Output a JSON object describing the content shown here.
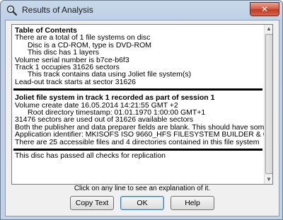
{
  "window": {
    "title": "Results of Analysis",
    "close_glyph": "✕"
  },
  "report": {
    "toc": {
      "heading": "Table of Contents",
      "lines": [
        {
          "text": "There are a total of 1 file systems on disc",
          "indent": false
        },
        {
          "text": "Disc is a CD-ROM, type is DVD-ROM",
          "indent": true
        },
        {
          "text": "This disc has 1 layers",
          "indent": true
        },
        {
          "text": "Volume serial number is b7ce-b6f3",
          "indent": false
        },
        {
          "text": "Track 1 occupies 31626 sectors",
          "indent": false
        },
        {
          "text": "This track contains data using Joliet file system(s)",
          "indent": true
        },
        {
          "text": "Lead-out track starts at sector 31626",
          "indent": false
        }
      ]
    },
    "joliet": {
      "heading": "Joliet file system in track 1 recorded as part of session 1",
      "lines": [
        {
          "text": "Volume create date 16.05.2014  14:21:55 GMT +2",
          "indent": false
        },
        {
          "text": "Root directory timestamp: 01.01.1970 1:00:00 GMT+1",
          "indent": true
        },
        {
          "text": "31476 sectors are used out of 31626 available sectors",
          "indent": false
        },
        {
          "text": "Both the publisher and data preparer fields are blank.  This should have somebo",
          "indent": false
        },
        {
          "text": "Application identifier: MKISOFS ISO 9660_HFS FILESYSTEM BUILDER & CDR",
          "indent": false
        },
        {
          "text": "There are 25 accessible files and 4 directories contained in this file system",
          "indent": false
        }
      ]
    },
    "final_line": "This disc has passed all checks for replication"
  },
  "hint": "Click on any line to see an explanation of it.",
  "buttons": {
    "copy_text": "Copy Text",
    "ok": "OK",
    "help": "Help"
  }
}
